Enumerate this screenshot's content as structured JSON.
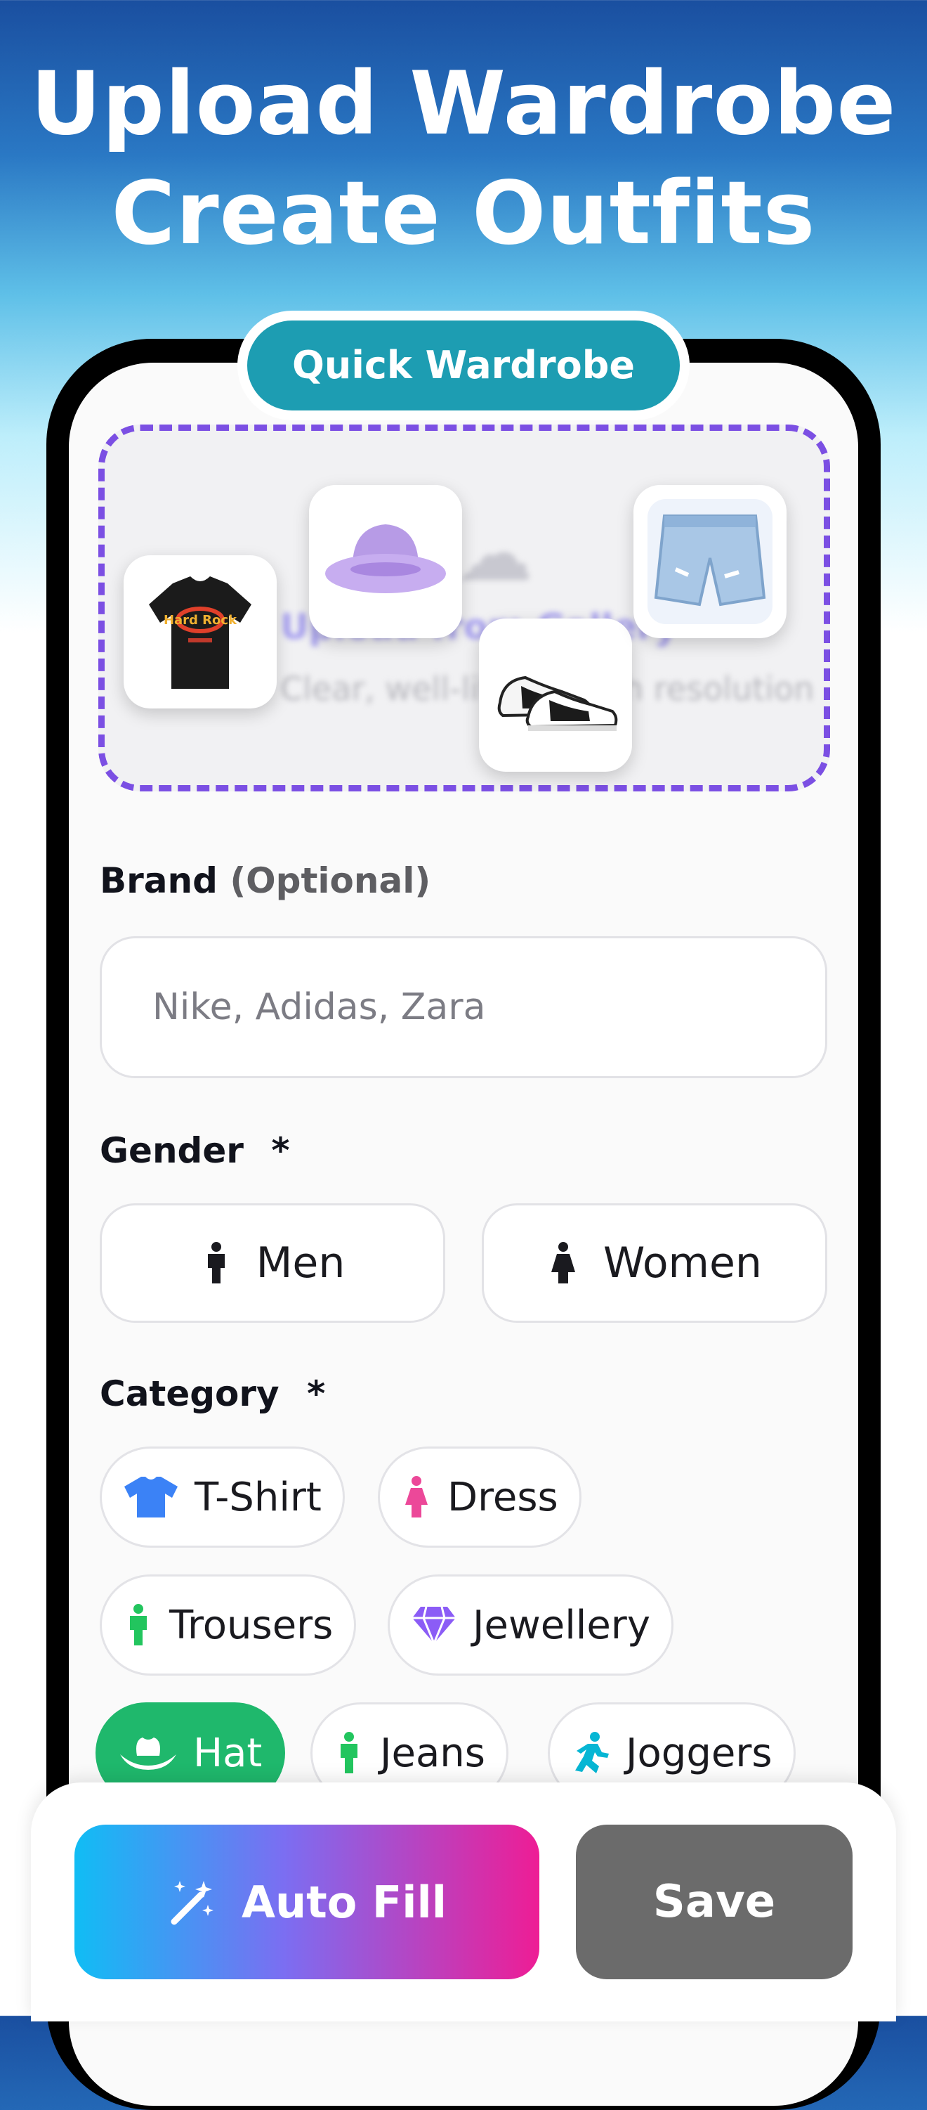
{
  "headline": {
    "line1": "Upload Wardrobe",
    "line2": "Create Outfits"
  },
  "badge": {
    "label": "Quick Wardrobe"
  },
  "upload": {
    "title": "Upload from Gallery",
    "subtitle": "Clear, well-lit and high resolution",
    "thumbnails": [
      "t-shirt",
      "bucket-hat",
      "sneakers",
      "denim-shorts"
    ]
  },
  "brand": {
    "label": "Brand",
    "optional": "(Optional)",
    "placeholder": "Nike, Adidas, Zara"
  },
  "gender": {
    "label": "Gender",
    "required": "*",
    "options": [
      "Men",
      "Women"
    ]
  },
  "category": {
    "label": "Category",
    "required": "*",
    "chips": [
      {
        "label": "T-Shirt",
        "icon": "tshirt-icon",
        "color": "#3b82f6"
      },
      {
        "label": "Dress",
        "icon": "dress-icon",
        "color": "#ec4899"
      },
      {
        "label": "Trousers",
        "icon": "person-icon",
        "color": "#22c55e"
      },
      {
        "label": "Jewellery",
        "icon": "gem-icon",
        "color": "#8b5cf6"
      },
      {
        "label": "Hat",
        "icon": "hat-icon",
        "color": "#ffffff",
        "selected": true
      },
      {
        "label": "Jeans",
        "icon": "person-icon",
        "color": "#22c55e"
      },
      {
        "label": "Joggers",
        "icon": "runner-icon",
        "color": "#06b6d4"
      }
    ]
  },
  "actions": {
    "autofill": "Auto Fill",
    "save": "Save"
  }
}
